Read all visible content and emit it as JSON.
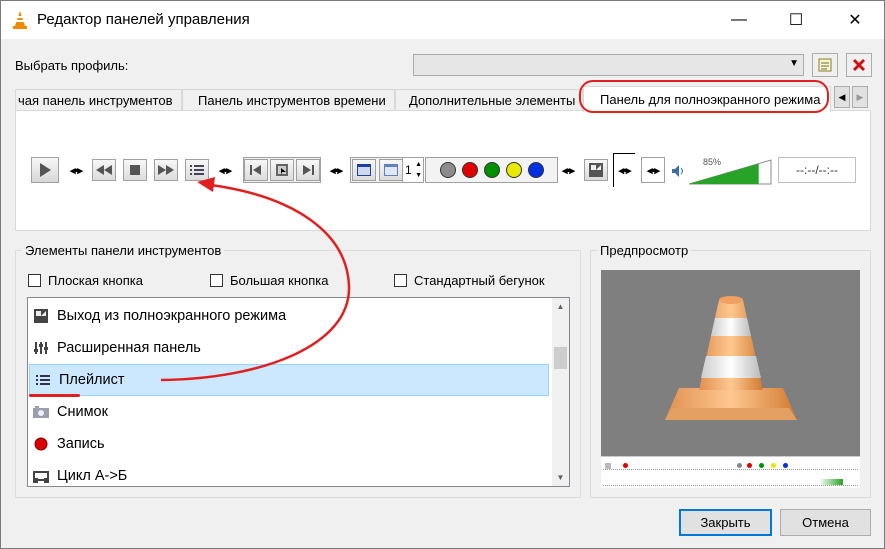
{
  "window": {
    "title": "Редактор панелей управления",
    "controls": {
      "minimize": "—",
      "maximize": "☐",
      "close": "✕"
    }
  },
  "profile": {
    "label": "Выбрать профиль:",
    "selected": ""
  },
  "tabs": [
    {
      "label": "чая панель инструментов",
      "active": false
    },
    {
      "label": "Панель инструментов времени",
      "active": false
    },
    {
      "label": "Дополнительные элементы",
      "active": false
    },
    {
      "label": "Панель для полноэкранного режима",
      "active": true
    }
  ],
  "toolbar_preview": {
    "volume_percent": "85%",
    "volume_level": 0.85,
    "time_display": "--:--/--:--",
    "spin_value": "1",
    "colors": {
      "grey": "#8c8c8c",
      "red": "#e00000",
      "green": "#009000",
      "yellow": "#e8e800",
      "blue": "#0030e0"
    }
  },
  "elements_group": {
    "title": "Элементы панели инструментов",
    "checkboxes": [
      {
        "label": "Плоская кнопка",
        "checked": false
      },
      {
        "label": "Большая кнопка",
        "checked": false
      },
      {
        "label": "Стандартный бегунок",
        "checked": false
      }
    ],
    "items": [
      {
        "label": "Выход из полноэкранного режима",
        "icon": "fullscreen-exit-icon",
        "selected": false
      },
      {
        "label": "Расширенная панель",
        "icon": "equalizer-icon",
        "selected": false
      },
      {
        "label": "Плейлист",
        "icon": "playlist-icon",
        "selected": true
      },
      {
        "label": "Снимок",
        "icon": "snapshot-icon",
        "selected": false
      },
      {
        "label": "Запись",
        "icon": "record-icon",
        "selected": false
      },
      {
        "label": "Цикл А->Б",
        "icon": "loop-ab-icon",
        "selected": false
      }
    ]
  },
  "preview_group": {
    "title": "Предпросмотр"
  },
  "buttons": {
    "close": "Закрыть",
    "cancel": "Отмена"
  },
  "accent_colors": {
    "annotation": "#e02020",
    "selection": "#cce8ff",
    "default_button": "#0078d7"
  }
}
